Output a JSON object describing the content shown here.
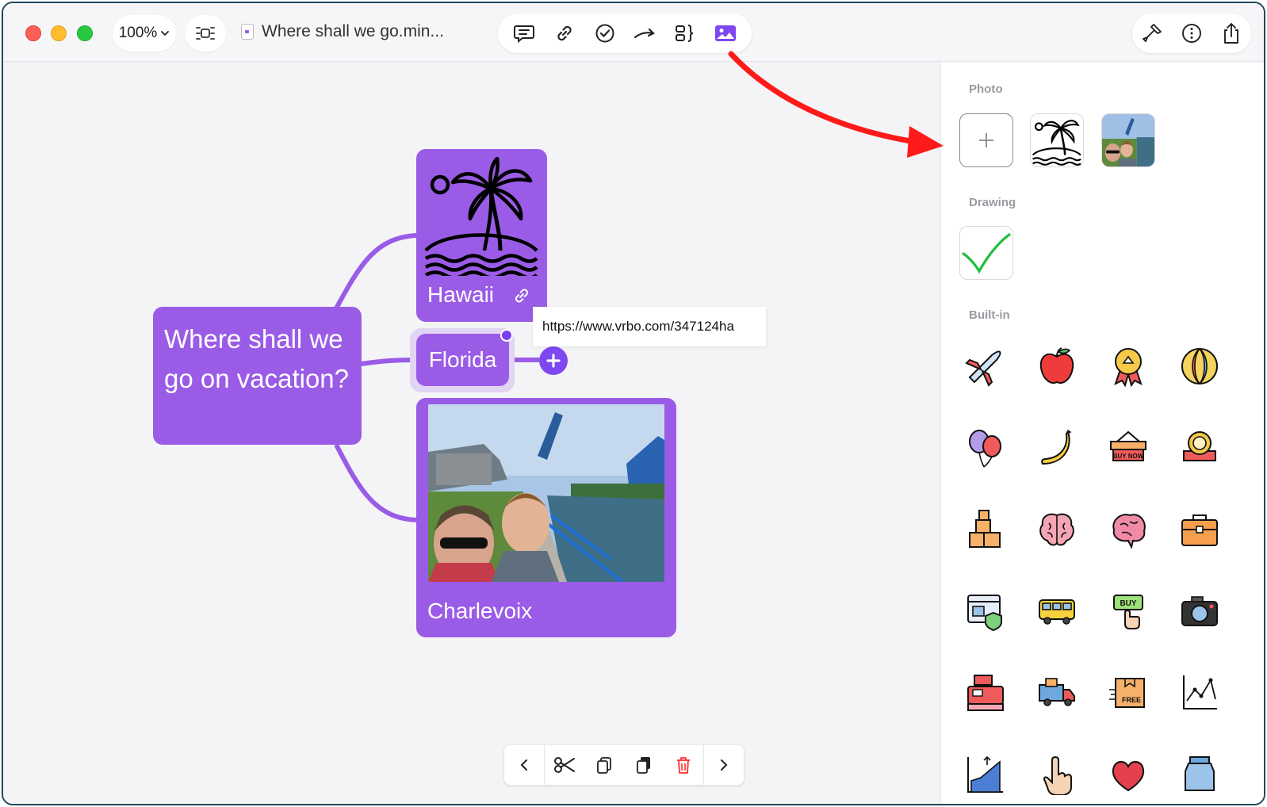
{
  "toolbar": {
    "zoom_label": "100%",
    "document_title": "Where shall we go.min...",
    "tools": [
      "comment-icon",
      "link-icon",
      "task-check-icon",
      "relationship-arrow-icon",
      "summary-bracket-icon",
      "image-icon"
    ],
    "right_tools": [
      "format-brush-icon",
      "info-icon",
      "share-icon"
    ]
  },
  "mindmap": {
    "root": {
      "text": "Where shall we go on vacation?"
    },
    "nodes": [
      {
        "label": "Hawaii",
        "image": "palm-island-icon",
        "has_link": true
      },
      {
        "label": "Florida",
        "selected": true
      },
      {
        "label": "Charlevoix",
        "image": "family-bridge-photo"
      }
    ],
    "link_tooltip": "https://www.vrbo.com/347124ha"
  },
  "bottom_bar": {
    "items": [
      "chevron-left-icon",
      "scissors-icon",
      "copy-icon",
      "paste-icon",
      "trash-icon",
      "chevron-right-icon"
    ]
  },
  "panel": {
    "photo_title": "Photo",
    "drawing_title": "Drawing",
    "builtin_title": "Built-in",
    "builtin_icons": [
      "airplane-icon",
      "apple-icon",
      "award-ribbon-icon",
      "beach-ball-icon",
      "balloons-icon",
      "banana-icon",
      "buy-now-basket-icon",
      "badge-banner-icon",
      "boxes-icon",
      "brain-icon",
      "brain-pink-icon",
      "briefcase-icon",
      "browser-shield-icon",
      "bus-icon",
      "buy-button-icon",
      "camera-icon",
      "cash-register-icon",
      "delivery-truck-icon",
      "free-box-icon",
      "line-chart-icon",
      "growth-chart-icon",
      "hand-pointer-icon",
      "heart-icon",
      "jar-icon"
    ]
  },
  "colors": {
    "node": "#9a5ce6",
    "accent": "#7d47f2",
    "annotation_arrow": "#ff1a1a"
  }
}
